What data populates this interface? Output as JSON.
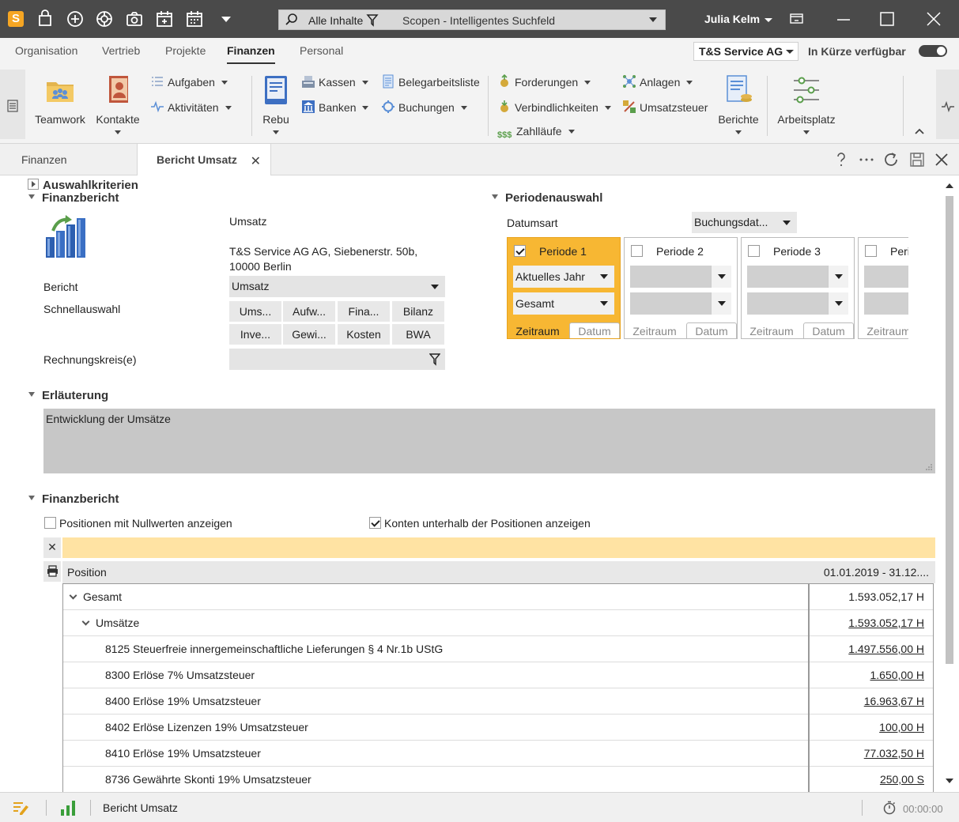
{
  "titlebar": {
    "logo": "S",
    "search_scope": "Alle Inhalte",
    "search_placeholder": "Scopen - Intelligentes Suchfeld",
    "user_name": "Julia Kelm",
    "icons": [
      "bag-icon",
      "plus-circle-icon",
      "lifebuoy-icon",
      "camera-icon",
      "calendar-add-icon",
      "calendar-icon",
      "dropdown-icon"
    ]
  },
  "ribbon_tabs": [
    "Organisation",
    "Vertrieb",
    "Projekte",
    "Finanzen",
    "Personal"
  ],
  "ribbon_active_tab": "Finanzen",
  "company": "T&S Service AG",
  "soon_label": "In Kürze verfügbar",
  "ribbon": {
    "teamwork": "Teamwork",
    "kontakte": "Kontakte",
    "aufgaben": "Aufgaben",
    "aktivitaeten": "Aktivitäten",
    "rebu": "Rebu",
    "kassen": "Kassen",
    "banken": "Banken",
    "belegarbeitsliste": "Belegarbeitsliste",
    "buchungen": "Buchungen",
    "forderungen": "Forderungen",
    "verbindlichkeiten": "Verbindlichkeiten",
    "zahllaeufe": "Zahlläufe",
    "anlagen": "Anlagen",
    "umsatzsteuer": "Umsatzsteuer",
    "berichte": "Berichte",
    "arbeitsplatz": "Arbeitsplatz"
  },
  "doc_tabs": {
    "inactive": "Finanzen",
    "active": "Bericht Umsatz"
  },
  "sections": {
    "auswahlkriterien": "Auswahlkriterien",
    "finanzbericht_top": "Finanzbericht",
    "periodenauswahl": "Periodenauswahl",
    "erlaeuterung": "Erläuterung",
    "finanzbericht_bottom": "Finanzbericht"
  },
  "report": {
    "title": "Umsatz",
    "address_line1": "T&S Service AG AG, Siebenerstr. 50b,",
    "address_line2": "10000 Berlin",
    "bericht_label": "Bericht",
    "bericht_value": "Umsatz",
    "schnellauswahl_label": "Schnellauswahl",
    "quick_buttons": [
      "Ums...",
      "Aufw...",
      "Fina...",
      "Bilanz",
      "Inve...",
      "Gewi...",
      "Kosten",
      "BWA"
    ],
    "rechnungskreis_label": "Rechnungskreis(e)"
  },
  "perioden": {
    "datumsart_label": "Datumsart",
    "datumsart_value": "Buchungsdat...",
    "periods": [
      {
        "title": "Periode 1",
        "checked": true,
        "dd1": "Aktuelles Jahr",
        "dd2": "Gesamt"
      },
      {
        "title": "Periode 2",
        "checked": false,
        "dd1": "",
        "dd2": ""
      },
      {
        "title": "Periode 3",
        "checked": false,
        "dd1": "",
        "dd2": ""
      },
      {
        "title": "Peri",
        "checked": false,
        "dd1": "",
        "dd2": ""
      }
    ],
    "tab_zeitraum": "Zeitraum",
    "tab_datum": "Datum"
  },
  "erlaeuterung_text": "Entwicklung der Umsätze",
  "options": {
    "nullwerte": "Positionen mit Nullwerten anzeigen",
    "nullwerte_checked": false,
    "konten": "Konten unterhalb der Positionen anzeigen",
    "konten_checked": true
  },
  "table": {
    "col_position": "Position",
    "col_period": "01.01.2019 - 31.12....",
    "rows": [
      {
        "name": "Gesamt",
        "value": "1.593.052,17 H"
      },
      {
        "name": "Umsätze",
        "value": "1.593.052,17 H"
      },
      {
        "name": "8125 Steuerfreie innergemeinschaftliche Lieferungen § 4 Nr.1b UStG",
        "value": "1.497.556,00 H"
      },
      {
        "name": "8300 Erlöse 7% Umsatzsteuer",
        "value": "1.650,00 H"
      },
      {
        "name": "8400 Erlöse 19% Umsatzsteuer",
        "value": "16.963,67 H"
      },
      {
        "name": "8402 Erlöse Lizenzen 19% Umsatzsteuer",
        "value": "100,00 H"
      },
      {
        "name": "8410 Erlöse 19% Umsatzsteuer",
        "value": "77.032,50 H"
      },
      {
        "name": "8736 Gewährte Skonti 19% Umsatzsteuer",
        "value": "250,00 S"
      }
    ]
  },
  "statusbar": {
    "text": "Bericht Umsatz",
    "timer": "00:00:00"
  },
  "colors": {
    "accent": "#f7b733",
    "titlebar": "#4a4a4a",
    "filter_row": "#ffe3a3"
  }
}
